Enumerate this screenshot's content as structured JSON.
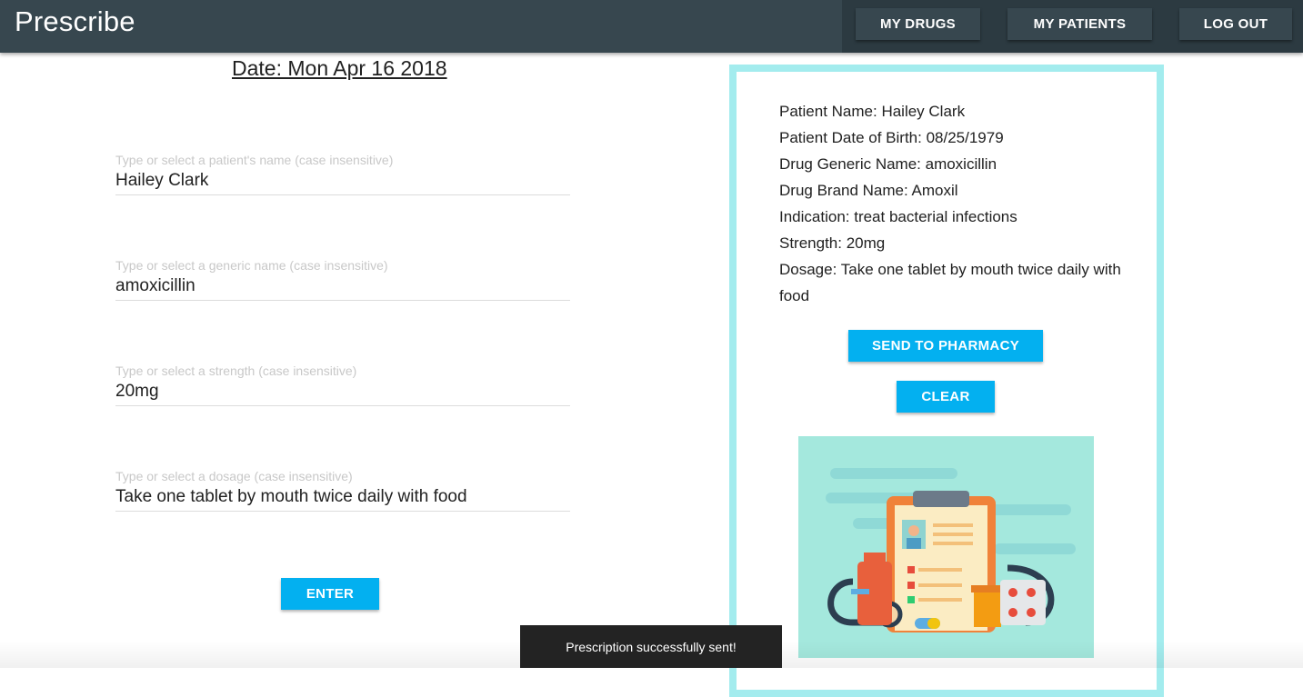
{
  "header": {
    "brand": "Prescribe",
    "nav": {
      "my_drugs": "MY DRUGS",
      "my_patients": "MY PATIENTS",
      "log_out": "LOG OUT"
    }
  },
  "form": {
    "date": "Date:  Mon Apr 16 2018",
    "fields": [
      {
        "placeholder": "Type or select a patient's name (case insensitive)",
        "value": "Hailey Clark"
      },
      {
        "placeholder": "Type or select a generic name (case insensitive)",
        "value": "amoxicillin"
      },
      {
        "placeholder": "Type or select a strength (case insensitive)",
        "value": "20mg"
      },
      {
        "placeholder": "Type or select a dosage (case insensitive)",
        "value": "Take one tablet by mouth twice daily with food"
      }
    ],
    "enter_label": "ENTER"
  },
  "summary": {
    "patient_name": "Patient Name:   Hailey Clark",
    "dob": "Patient Date of Birth:  08/25/1979",
    "generic": "Drug Generic Name:  amoxicillin",
    "brand": "Drug Brand Name:  Amoxil",
    "indication": "Indication:  treat bacterial infections",
    "strength": "Strength:  20mg",
    "dosage": "Dosage:  Take one tablet by mouth twice daily with food",
    "send_label": "SEND TO PHARMACY",
    "clear_label": "CLEAR"
  },
  "snackbar": {
    "message": "Prescription successfully sent!"
  },
  "colors": {
    "header_bg": "#37474f",
    "accent": "#03b0f0",
    "card_border": "#a3ecee"
  }
}
